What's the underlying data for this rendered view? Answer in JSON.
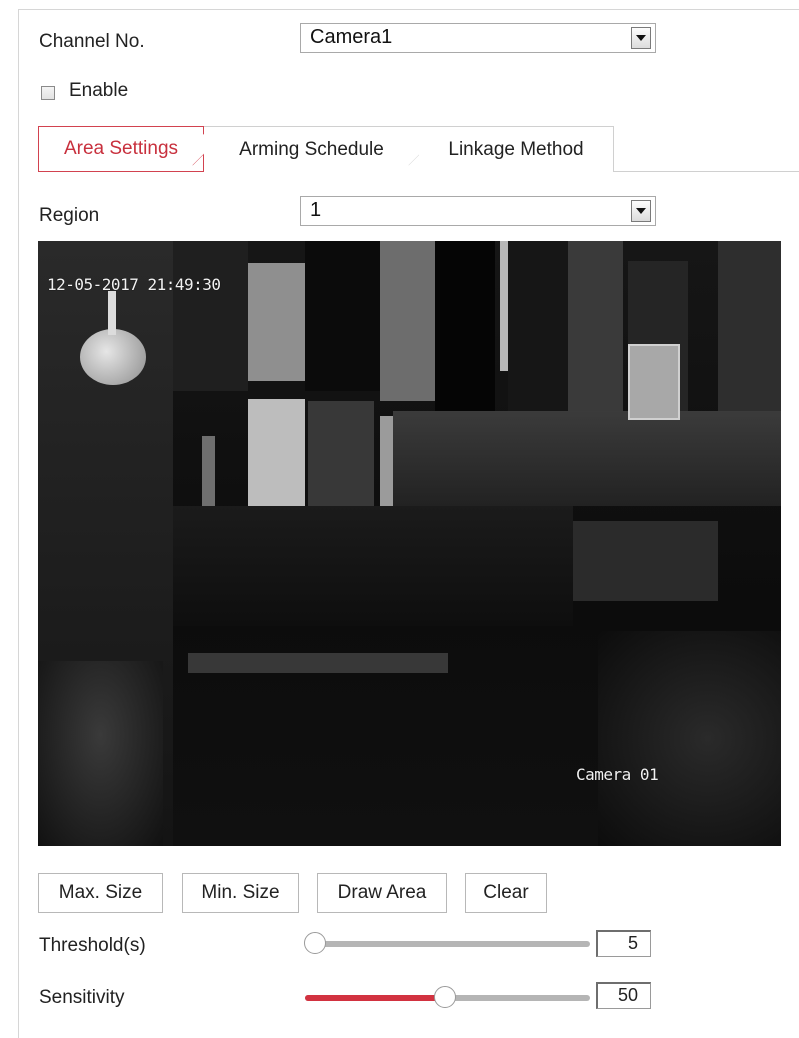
{
  "channel": {
    "label": "Channel No.",
    "value": "Camera1"
  },
  "enable": {
    "label": "Enable",
    "checked": false
  },
  "tabs": [
    {
      "label": "Area Settings",
      "active": true
    },
    {
      "label": "Arming Schedule",
      "active": false
    },
    {
      "label": "Linkage Method",
      "active": false
    }
  ],
  "region": {
    "label": "Region",
    "value": "1"
  },
  "video": {
    "timestamp": "12-05-2017 21:49:30",
    "camera_name": "Camera 01"
  },
  "buttons": {
    "max_size": "Max. Size",
    "min_size": "Min. Size",
    "draw_area": "Draw Area",
    "clear": "Clear"
  },
  "threshold": {
    "label": "Threshold(s)",
    "value": "5",
    "level": 0
  },
  "sensitivity": {
    "label": "Sensitivity",
    "value": "50",
    "level": 50
  },
  "colors": {
    "accent": "#d23240",
    "tab_border": "#d2424f"
  }
}
